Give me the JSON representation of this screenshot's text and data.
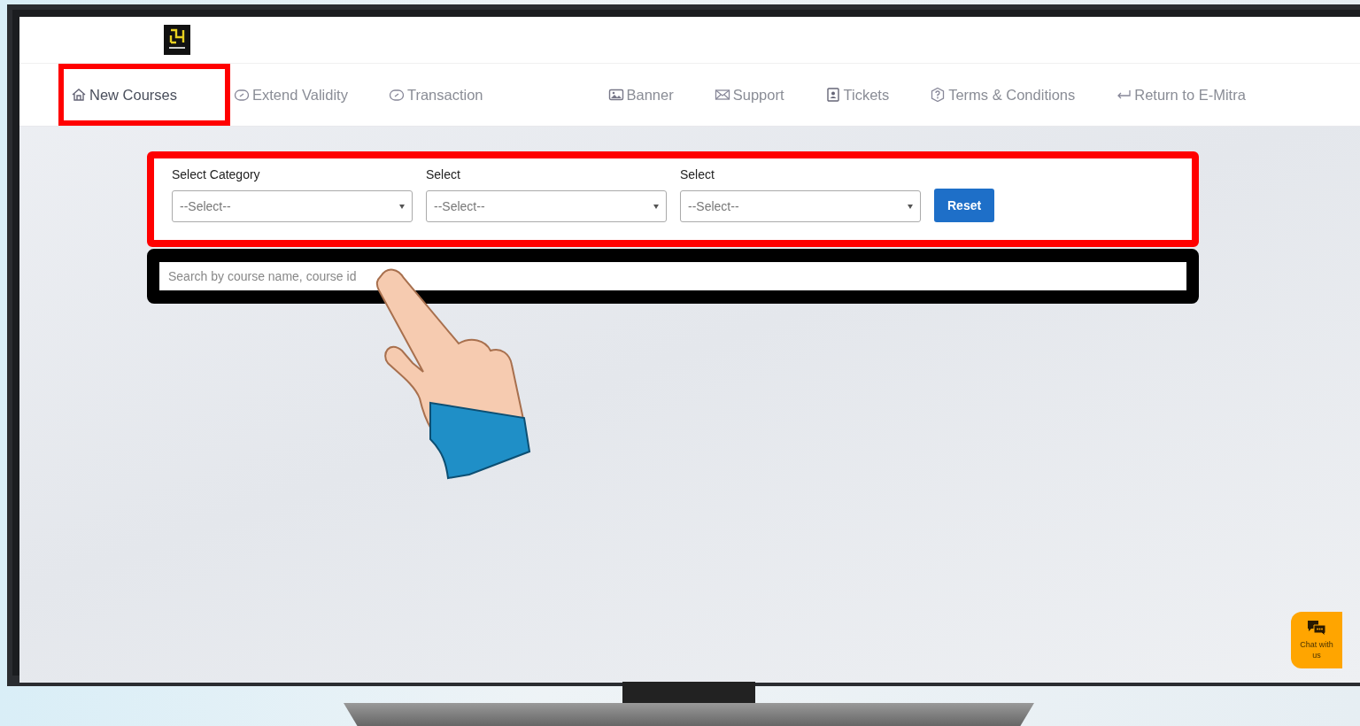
{
  "nav": {
    "tabs": [
      {
        "label": "New Courses",
        "kind": "home",
        "selected": true,
        "highlighted": true
      },
      {
        "label": "Extend Validity",
        "kind": "gauge",
        "selected": false,
        "highlighted": false
      },
      {
        "label": "Transaction",
        "kind": "gauge",
        "selected": false,
        "highlighted": false
      },
      {
        "label": "Banner",
        "kind": "image",
        "selected": false,
        "highlighted": false
      },
      {
        "label": "Support",
        "kind": "mail",
        "selected": false,
        "highlighted": false
      },
      {
        "label": "Tickets",
        "kind": "badge",
        "selected": false,
        "highlighted": false
      },
      {
        "label": "Terms & Conditions",
        "kind": "help",
        "selected": false,
        "highlighted": false
      },
      {
        "label": "Return to E-Mitra",
        "kind": "return",
        "selected": false,
        "highlighted": false
      }
    ]
  },
  "filters": {
    "highlighted": true,
    "fields": [
      {
        "label": "Select Category",
        "value": "--Select--"
      },
      {
        "label": "Select",
        "value": "--Select--"
      },
      {
        "label": "Select",
        "value": "--Select--"
      }
    ],
    "reset": "Reset"
  },
  "search": {
    "placeholder": "Search by course name, course id",
    "highlighted": true
  },
  "chat": {
    "label": "Chat with us"
  }
}
